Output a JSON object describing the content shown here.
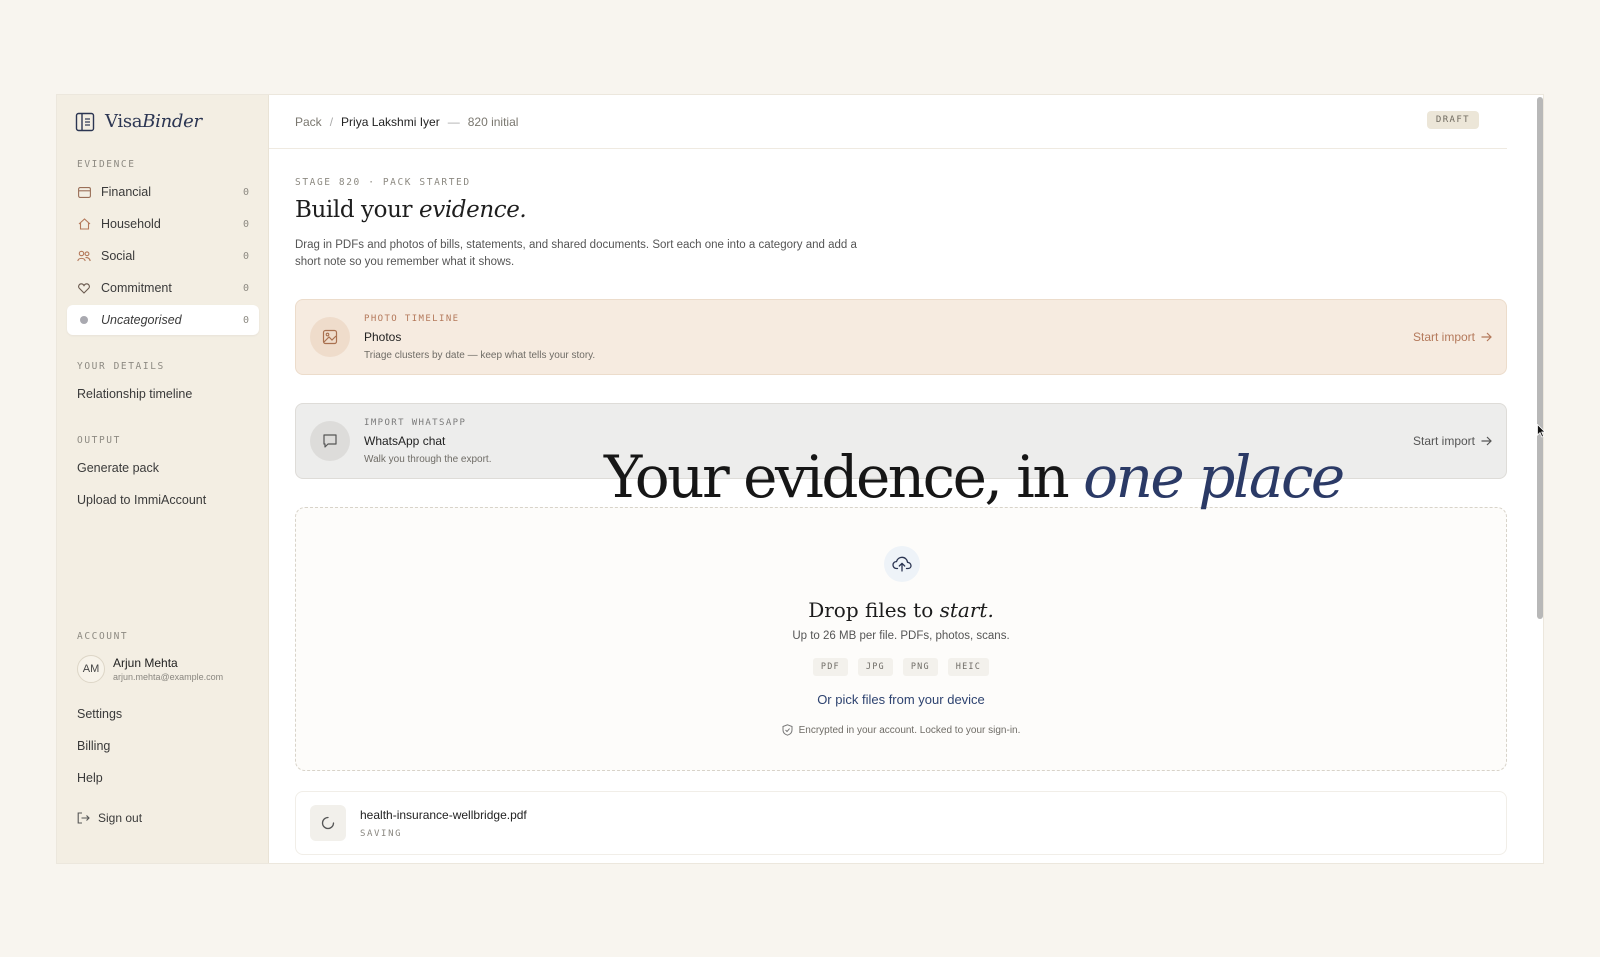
{
  "brand": {
    "name_plain": "Visa",
    "name_italic": "Binder"
  },
  "sidebar": {
    "evidence_label": "EVIDENCE",
    "evidence_items": [
      {
        "label": "Financial",
        "count": "0",
        "icon": "card-icon"
      },
      {
        "label": "Household",
        "count": "0",
        "icon": "home-icon"
      },
      {
        "label": "Social",
        "count": "0",
        "icon": "people-icon"
      },
      {
        "label": "Commitment",
        "count": "0",
        "icon": "heart-icon"
      },
      {
        "label": "Uncategorised",
        "count": "0",
        "icon": "dot-icon"
      }
    ],
    "details_label": "YOUR DETAILS",
    "details_items": [
      "Relationship timeline"
    ],
    "output_label": "OUTPUT",
    "output_items": [
      "Generate pack",
      "Upload to ImmiAccount"
    ],
    "account_label": "ACCOUNT",
    "account": {
      "initials": "AM",
      "name": "Arjun Mehta",
      "email": "arjun.mehta@example.com"
    },
    "account_items": [
      "Settings",
      "Billing",
      "Help"
    ],
    "signout": "Sign out"
  },
  "topbar": {
    "crumb_root": "Pack",
    "crumb_sep": "/",
    "crumb_name": "Priya Lakshmi Iyer",
    "crumb_dash": "—",
    "crumb_stage": "820 initial",
    "badge": "DRAFT"
  },
  "main": {
    "stage": "STAGE 820 · PACK STARTED",
    "title_plain": "Build your ",
    "title_italic": "evidence.",
    "description": "Drag in PDFs and photos of bills, statements, and shared documents. Sort each one into a category and add a short note so you remember what it shows.",
    "cards": [
      {
        "kicker": "PHOTO TIMELINE",
        "title": "Photos",
        "subtitle": "Triage clusters by date — keep what tells your story.",
        "cta": "Start import"
      },
      {
        "kicker": "IMPORT WHATSAPP",
        "title": "WhatsApp chat",
        "subtitle": "Walk you through the export.",
        "cta": "Start import"
      }
    ],
    "overlay_plain": "Your evidence, in ",
    "overlay_italic": "one place",
    "dropzone": {
      "title_plain": "Drop files to ",
      "title_italic": "start.",
      "subtitle": "Up to 26 MB per file. PDFs, photos, scans.",
      "formats": [
        "PDF",
        "JPG",
        "PNG",
        "HEIC"
      ],
      "link": "Or pick files from your device",
      "note": "Encrypted in your account. Locked to your sign-in."
    },
    "file": {
      "name": "health-insurance-wellbridge.pdf",
      "status": "SAVING"
    }
  },
  "colors": {
    "accent": "#2b3a66",
    "terracotta": "#b4795b",
    "sidebar_bg": "#f3eee3"
  }
}
